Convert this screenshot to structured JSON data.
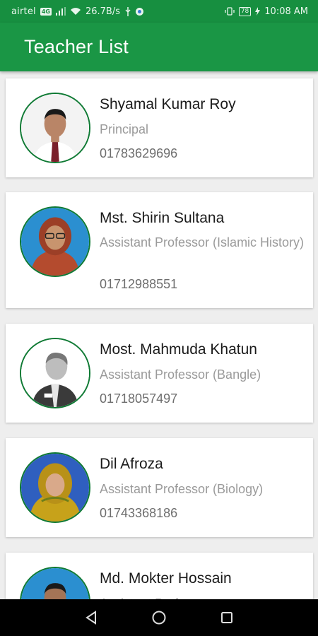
{
  "status_bar": {
    "carrier": "airtel",
    "network_badge": "4G",
    "speed": "26.7B/s",
    "battery": "78",
    "time": "10:08 AM"
  },
  "app_bar": {
    "title": "Teacher List"
  },
  "teachers": [
    {
      "name": "Shyamal Kumar Roy",
      "role": "Principal",
      "phone": "01783629696"
    },
    {
      "name": "Mst. Shirin Sultana",
      "role": "Assistant Professor (Islamic History)",
      "phone": "01712988551"
    },
    {
      "name": "Most. Mahmuda Khatun",
      "role": "Assistant Professor (Bangle)",
      "phone": "01718057497"
    },
    {
      "name": "Dil Afroza",
      "role": "Assistant Professor (Biology)",
      "phone": "01743368186"
    },
    {
      "name": "Md. Mokter Hossain",
      "role": "Assistant Profe...",
      "phone": ""
    }
  ],
  "colors": {
    "primary": "#1a9645",
    "status_bar": "#178f40",
    "avatar_border": "#0f7a34"
  },
  "icons": {
    "nav_back": "back-triangle-icon",
    "nav_home": "home-circle-icon",
    "nav_recents": "recents-square-icon"
  }
}
